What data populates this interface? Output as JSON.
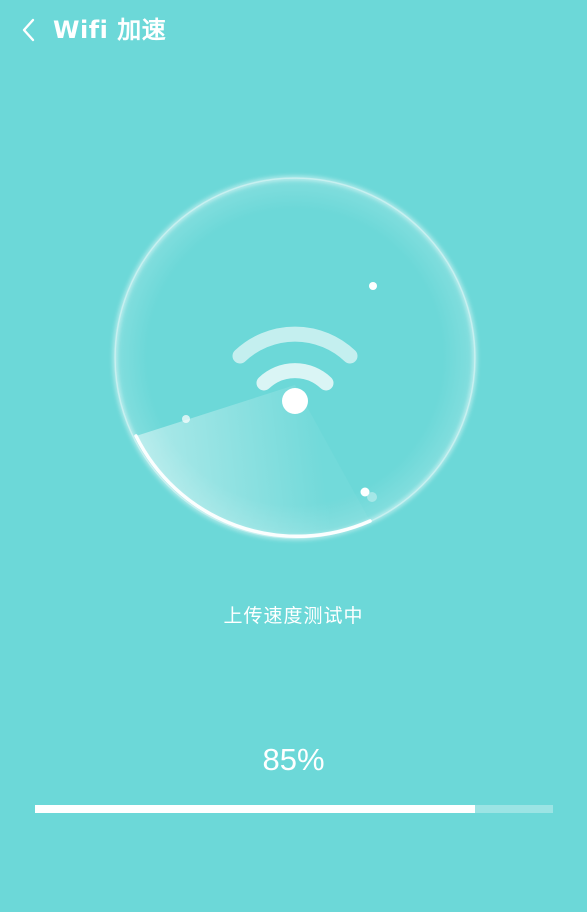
{
  "header": {
    "back_icon": "chevron-left-icon",
    "title": "Wifi 加速"
  },
  "radar": {
    "center_icon": "wifi-icon"
  },
  "status_text": "上传速度测试中",
  "progress": {
    "percent_label": "85%",
    "fraction": 0.85
  },
  "colors": {
    "background": "#6cd8d8",
    "foreground": "#ffffff"
  }
}
